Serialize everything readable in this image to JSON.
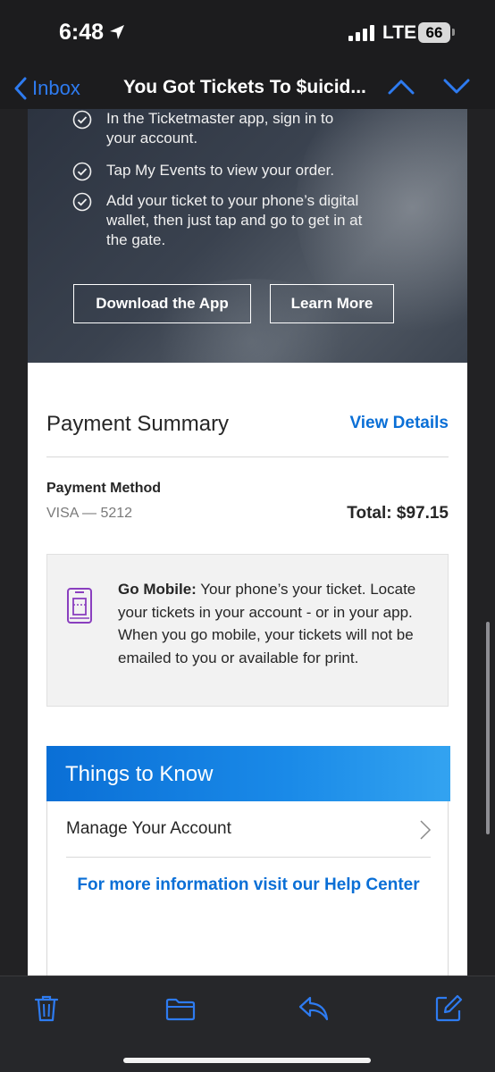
{
  "status_bar": {
    "time": "6:48",
    "network": "LTE",
    "battery": "66"
  },
  "nav": {
    "back_label": "Inbox",
    "title": "You Got Tickets To $uicid..."
  },
  "hero": {
    "steps": [
      "In the Ticketmaster app, sign in to your account.",
      "Tap My Events to view your order.",
      "Add your ticket to your phone’s digital wallet, then just tap and go to get in at the gate."
    ],
    "download_button": "Download the App",
    "learn_button": "Learn More"
  },
  "payment": {
    "title": "Payment Summary",
    "details_link": "View Details",
    "method_label": "Payment Method",
    "method_value": "VISA — 5212",
    "total": "Total: $97.15"
  },
  "go_mobile": {
    "heading": "Go Mobile:",
    "body": " Your phone’s your ticket. Locate your tickets in your account - or in your app. When you go mobile, your tickets will not be emailed to you or available for print."
  },
  "things": {
    "title": "Things to Know",
    "manage_label": "Manage Your Account",
    "help_text": "For more information visit our Help Center"
  },
  "colors": {
    "accent": "#0a6fd6",
    "ios_blue": "#2e7bf0",
    "phone_icon": "#8a3fbf"
  },
  "icons": {
    "back": "chevron-left-icon",
    "prev": "chevron-up-icon",
    "next": "chevron-down-icon",
    "trash": "trash-icon",
    "folder": "folder-icon",
    "reply": "reply-icon",
    "compose": "compose-icon"
  }
}
